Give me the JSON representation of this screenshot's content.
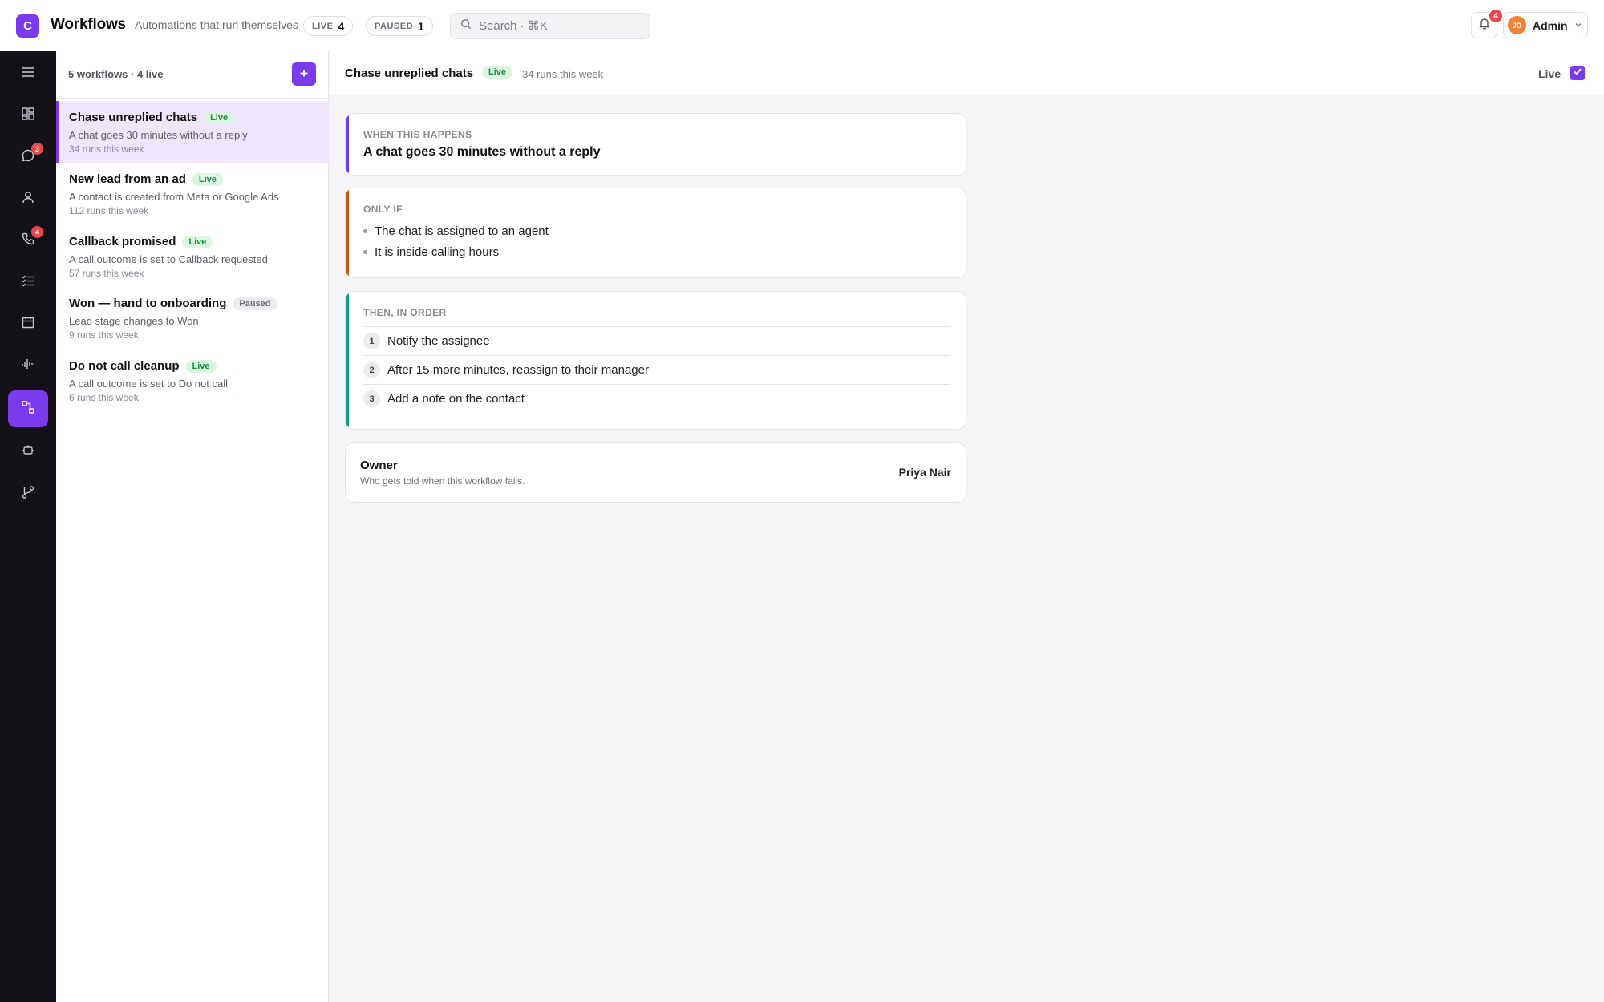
{
  "app": {
    "logo_letter": "C",
    "title": "Workflows",
    "subtitle": "Automations that run themselves",
    "brand_color": "#7c3aed"
  },
  "stats": {
    "live_label": "LIVE",
    "live_count": "4",
    "paused_label": "PAUSED",
    "paused_count": "1"
  },
  "search": {
    "placeholder": "Search · ⌘K"
  },
  "notifications": {
    "count": "4"
  },
  "user": {
    "initials": "JD",
    "name": "Admin"
  },
  "rail": {
    "items": [
      {
        "icon": "menu-icon"
      },
      {
        "icon": "dashboard-icon"
      },
      {
        "icon": "chat-icon",
        "badge": "3"
      },
      {
        "icon": "contacts-icon"
      },
      {
        "icon": "phone-icon",
        "badge": "4"
      },
      {
        "icon": "tasks-icon"
      },
      {
        "icon": "calendar-icon"
      },
      {
        "icon": "analytics-icon"
      },
      {
        "icon": "workflows-icon",
        "active": true
      },
      {
        "icon": "bot-icon"
      },
      {
        "icon": "integrations-icon"
      }
    ]
  },
  "list": {
    "summary": "5 workflows · 4 live",
    "add_label": "+",
    "items": [
      {
        "name": "Chase unreplied chats",
        "status": "Live",
        "desc": "A chat goes 30 minutes without a reply",
        "runs": "34 runs this week"
      },
      {
        "name": "New lead from an ad",
        "status": "Live",
        "desc": "A contact is created from Meta or Google Ads",
        "runs": "112 runs this week"
      },
      {
        "name": "Callback promised",
        "status": "Live",
        "desc": "A call outcome is set to Callback requested",
        "runs": "57 runs this week"
      },
      {
        "name": "Won — hand to onboarding",
        "status": "Paused",
        "desc": "Lead stage changes to Won",
        "runs": "9 runs this week"
      },
      {
        "name": "Do not call cleanup",
        "status": "Live",
        "desc": "A call outcome is set to Do not call",
        "runs": "6 runs this week"
      }
    ]
  },
  "detail": {
    "title": "Chase unreplied chats",
    "status": "Live",
    "runs": "34 runs this week",
    "live_toggle_label": "Live",
    "live_toggle_checked": true,
    "trigger": {
      "label": "WHEN THIS HAPPENS",
      "text": "A chat goes 30 minutes without a reply",
      "accent": "#6d3fe0"
    },
    "conditions": {
      "label": "ONLY IF",
      "items": [
        "The chat is assigned to an agent",
        "It is inside calling hours"
      ],
      "accent": "#c2571a"
    },
    "steps": {
      "label": "THEN, IN ORDER",
      "items": [
        {
          "num": "1",
          "text": "Notify the assignee"
        },
        {
          "num": "2",
          "text": "After 15 more minutes, reassign to their manager"
        },
        {
          "num": "3",
          "text": "Add a note on the contact"
        }
      ],
      "accent": "#0f9d8a"
    },
    "owner": {
      "title": "Owner",
      "subtitle": "Who gets told when this workflow fails.",
      "name": "Priya Nair"
    }
  }
}
